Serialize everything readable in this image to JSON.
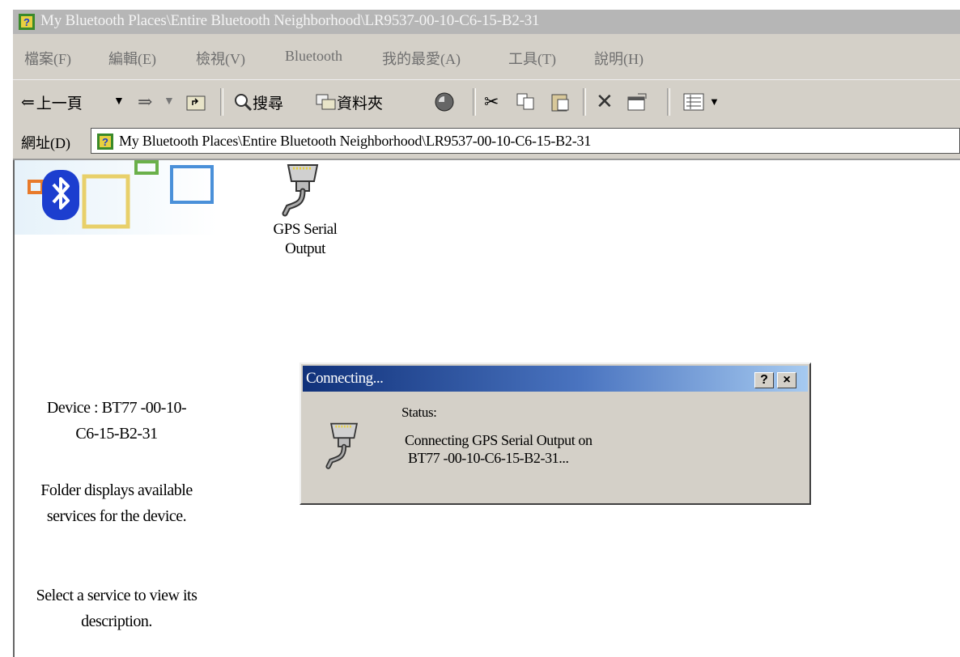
{
  "window": {
    "title": "My Bluetooth Places\\Entire Bluetooth Neighborhood\\LR9537-00-10-C6-15-B2-31"
  },
  "menubar": {
    "items": [
      {
        "label": "檔案(F)"
      },
      {
        "label": "編輯(E)"
      },
      {
        "label": "檢視(V)"
      },
      {
        "label": "Bluetooth"
      },
      {
        "label": "我的最愛(A)"
      },
      {
        "label": "工具(T)"
      },
      {
        "label": "說明(H)"
      }
    ]
  },
  "toolbar": {
    "back_label": "上一頁",
    "search_label": "搜尋",
    "folders_label": "資料夾"
  },
  "address": {
    "label": "網址(D)",
    "value": "My Bluetooth Places\\Entire Bluetooth Neighborhood\\LR9537-00-10-C6-15-B2-31"
  },
  "content": {
    "service_item": {
      "label_line1": "GPS Serial",
      "label_line2": "Output",
      "icon": "serial-port-icon"
    },
    "side_panel": {
      "device_line1": "Device : BT77 -00-10-",
      "device_line2": "C6-15-B2-31",
      "folder_line1": "Folder displays available",
      "folder_line2": "services for the device.",
      "select_line1": "Select a service to view its",
      "select_line2": "description."
    }
  },
  "dialog": {
    "title": "Connecting...",
    "help_label": "?",
    "close_label": "×",
    "status_label": "Status:",
    "message_line1": "Connecting GPS Serial Output on",
    "message_line2": "BT77  -00-10-C6-15-B2-31..."
  },
  "colors": {
    "dialog_title_start": "#10317a",
    "dialog_title_end": "#a6caf0",
    "bluetooth_blue": "#1c3ecf",
    "chrome_gray": "#d4d0c8"
  }
}
